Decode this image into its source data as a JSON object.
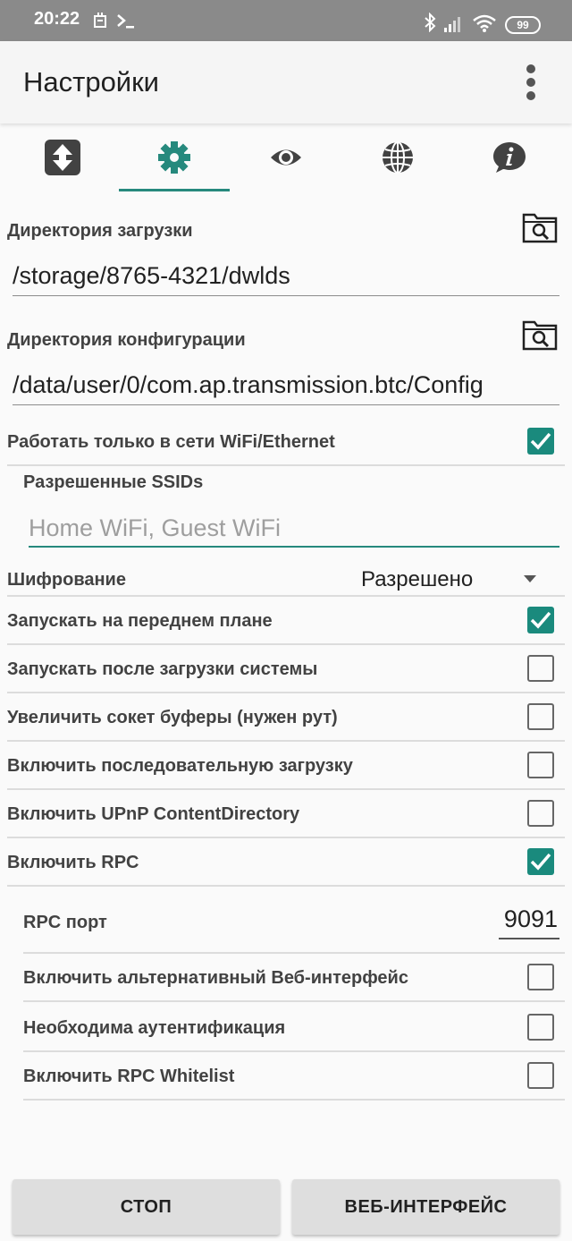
{
  "status_bar": {
    "time": "20:22",
    "battery": "99",
    "icons": [
      "notification-icon",
      "terminal-icon",
      "bluetooth-icon",
      "signal-icon",
      "wifi-icon",
      "battery-icon"
    ]
  },
  "app_bar": {
    "title": "Настройки",
    "menu_icon": "overflow-menu-icon"
  },
  "tabs": [
    {
      "icon": "transfer-icon",
      "active": false
    },
    {
      "icon": "gear-icon",
      "active": true
    },
    {
      "icon": "eye-icon",
      "active": false
    },
    {
      "icon": "globe-icon",
      "active": false
    },
    {
      "icon": "info-icon",
      "active": false
    }
  ],
  "settings": {
    "download_dir": {
      "label": "Директория загрузки",
      "value": "/storage/8765-4321/dwlds"
    },
    "config_dir": {
      "label": "Директория конфигурации",
      "value": "/data/user/0/com.ap.transmission.btc/Config"
    },
    "wifi_only": {
      "label": "Работать только в сети WiFi/Ethernet",
      "checked": true
    },
    "allowed_ssids": {
      "label": "Разрешенные SSIDs",
      "value": "",
      "placeholder": "Home WiFi, Guest WiFi"
    },
    "encryption": {
      "label": "Шифрование",
      "value": "Разрешено"
    },
    "foreground": {
      "label": "Запускать на переднем плане",
      "checked": true
    },
    "boot_start": {
      "label": "Запускать после загрузки системы",
      "checked": false
    },
    "socket_buffers": {
      "label": "Увеличить сокет буферы (нужен рут)",
      "checked": false
    },
    "sequential": {
      "label": "Включить последовательную загрузку",
      "checked": false
    },
    "upnp": {
      "label": "Включить UPnP ContentDirectory",
      "checked": false
    },
    "rpc": {
      "label": "Включить RPC",
      "checked": true
    },
    "rpc_port": {
      "label": "RPC порт",
      "value": "9091"
    },
    "alt_web": {
      "label": "Включить альтернативный Веб-интерфейс",
      "checked": false
    },
    "auth": {
      "label": "Необходима аутентификация",
      "checked": false
    },
    "rpc_whitelist": {
      "label": "Включить RPC Whitelist",
      "checked": false
    }
  },
  "buttons": {
    "stop": "СТОП",
    "web_ui": "ВЕБ-ИНТЕРФЕЙС"
  },
  "colors": {
    "accent": "#26897d",
    "checkbox_on": "#1a8a7d",
    "status_bar": "#8a8a8a"
  }
}
